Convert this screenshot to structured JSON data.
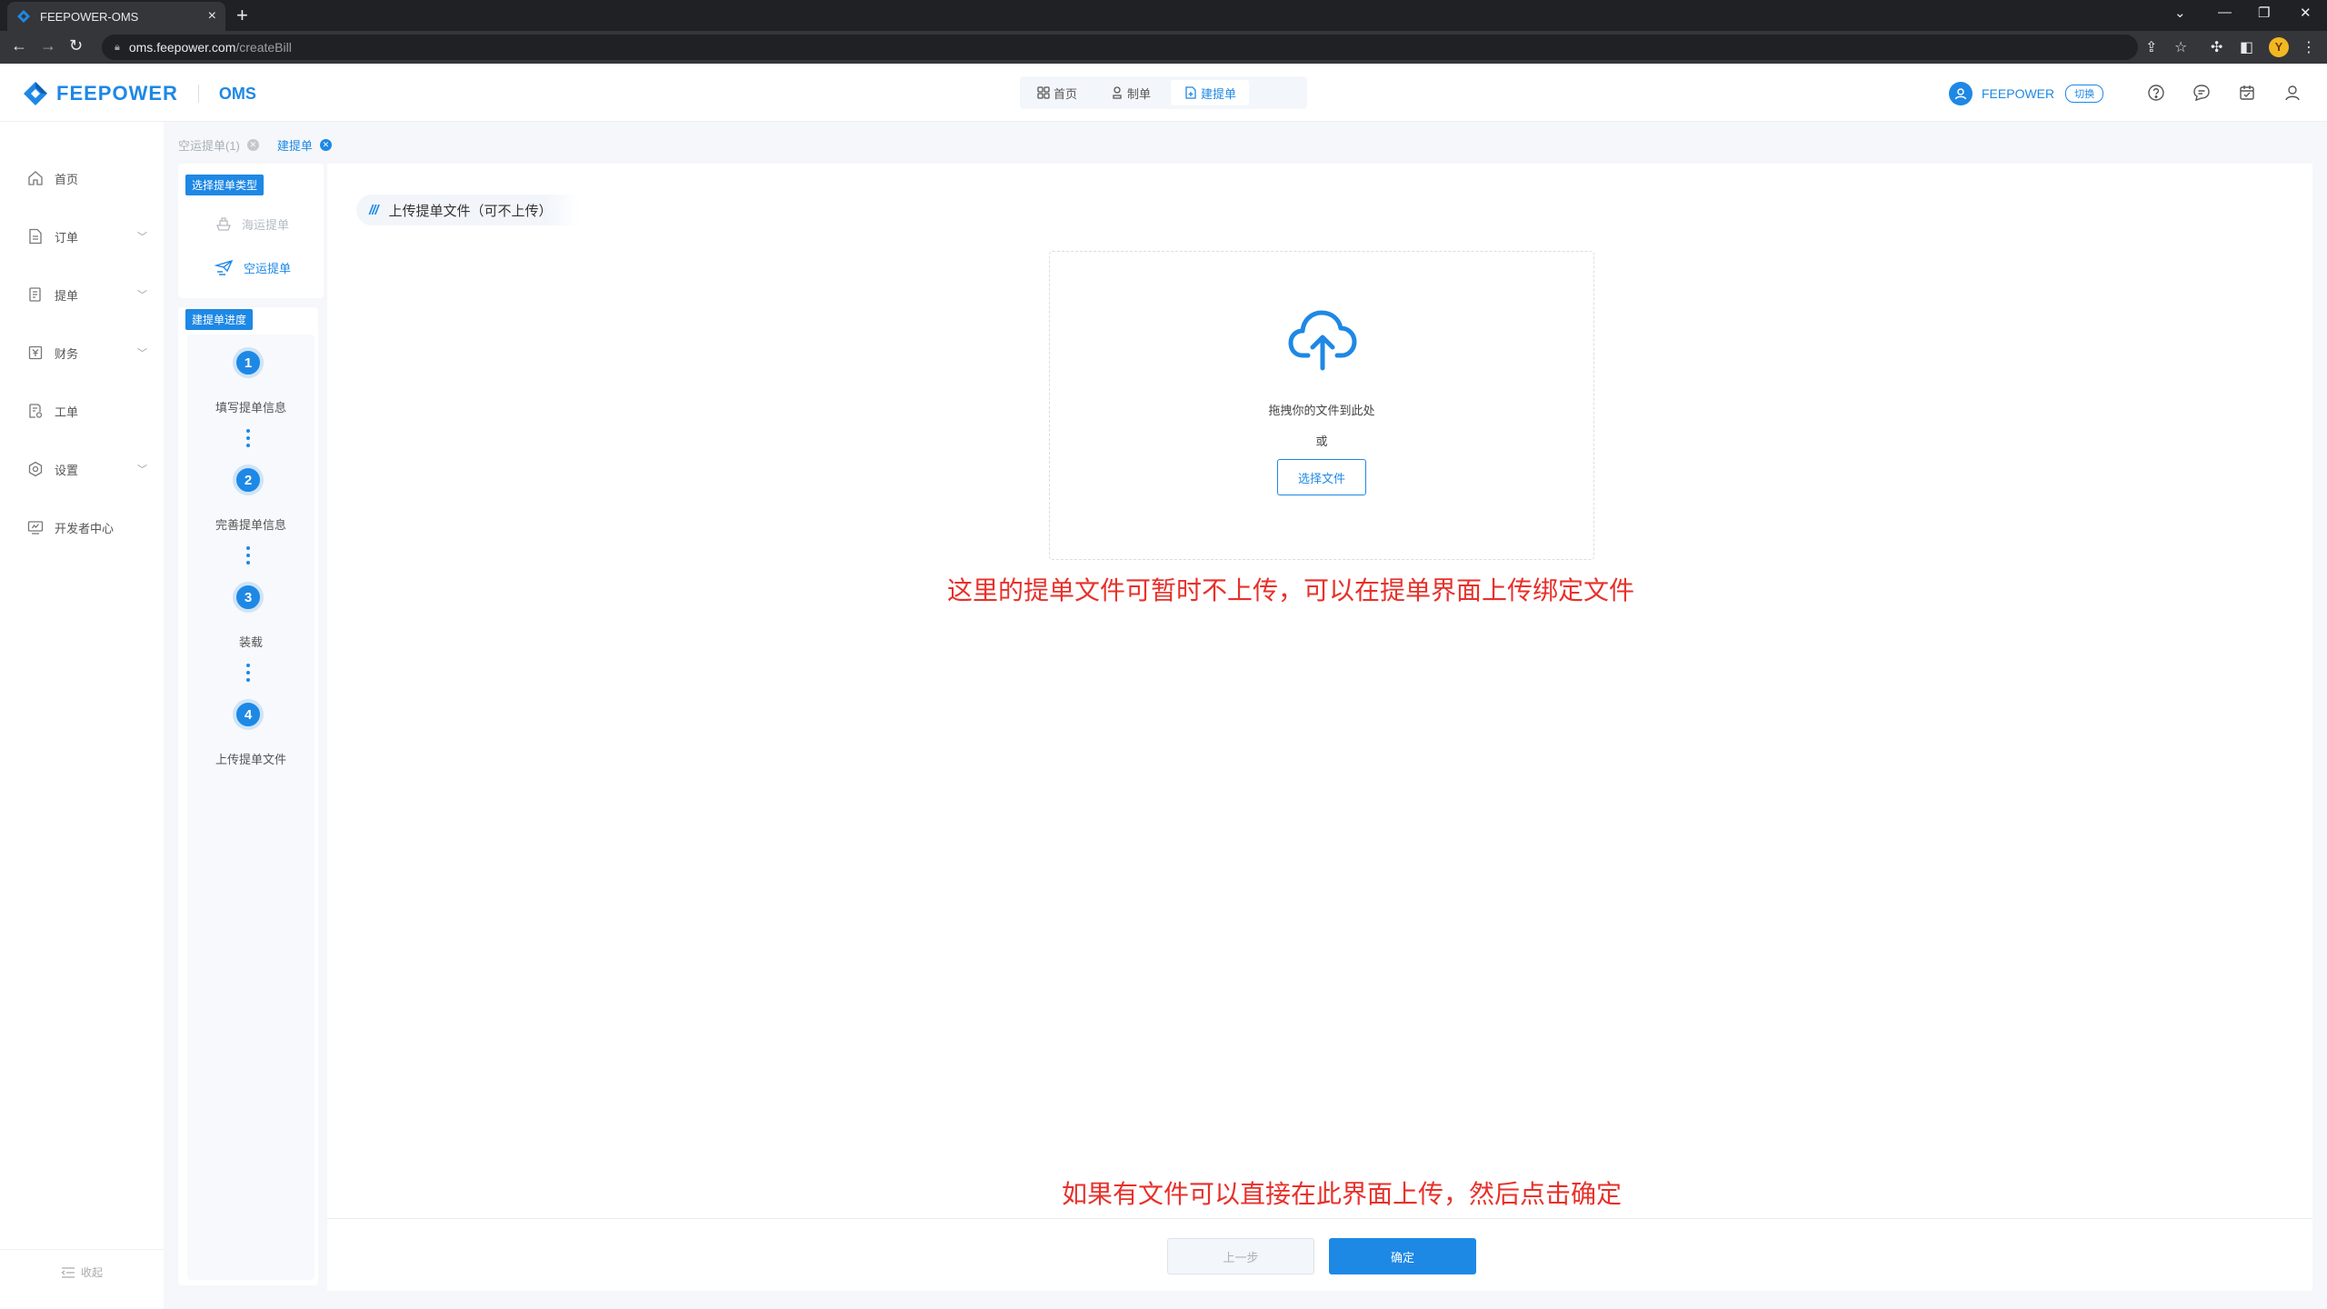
{
  "browser": {
    "tab_title": "FEEPOWER-OMS",
    "url_host": "oms.feepower.com",
    "url_path": "/createBill"
  },
  "header": {
    "brand": "FEEPOWER",
    "product": "OMS",
    "nav": [
      {
        "label": "首页",
        "icon": "grid-icon",
        "active": false
      },
      {
        "label": "制单",
        "icon": "stamp-icon",
        "active": false
      },
      {
        "label": "建提单",
        "icon": "add-doc-icon",
        "active": true
      }
    ],
    "user": "FEEPOWER",
    "switch_label": "切换"
  },
  "sidebar": {
    "items": [
      {
        "label": "首页",
        "icon": "home-icon",
        "expandable": false
      },
      {
        "label": "订单",
        "icon": "order-icon",
        "expandable": true
      },
      {
        "label": "提单",
        "icon": "bill-icon",
        "expandable": true
      },
      {
        "label": "财务",
        "icon": "finance-icon",
        "expandable": true
      },
      {
        "label": "工单",
        "icon": "ticket-icon",
        "expandable": false
      },
      {
        "label": "设置",
        "icon": "settings-icon",
        "expandable": true
      },
      {
        "label": "开发者中心",
        "icon": "developer-icon",
        "expandable": false
      }
    ],
    "collapse_label": "收起"
  },
  "tags": [
    {
      "label": "空运提单(1)",
      "active": false
    },
    {
      "label": "建提单",
      "active": true
    }
  ],
  "type_panel": {
    "badge": "选择提单类型",
    "options": [
      {
        "label": "海运提单",
        "icon": "ship-icon",
        "state": "disabled"
      },
      {
        "label": "空运提单",
        "icon": "plane-icon",
        "state": "active"
      }
    ]
  },
  "progress": {
    "badge": "建提单进度",
    "steps": [
      {
        "num": "1",
        "label": "填写提单信息"
      },
      {
        "num": "2",
        "label": "完善提单信息"
      },
      {
        "num": "3",
        "label": "装载"
      },
      {
        "num": "4",
        "label": "上传提单文件"
      }
    ]
  },
  "main": {
    "section_title": "上传提单文件（可不上传）",
    "drop_text": "拖拽你的文件到此处",
    "or_text": "或",
    "select_button": "选择文件",
    "annotation_top": "这里的提单文件可暂时不上传，可以在提单界面上传绑定文件",
    "annotation_bottom": "如果有文件可以直接在此界面上传，然后点击确定",
    "prev_button": "上一步",
    "ok_button": "确定"
  },
  "colors": {
    "accent": "#1e88e5",
    "annotation": "#e8302a"
  }
}
